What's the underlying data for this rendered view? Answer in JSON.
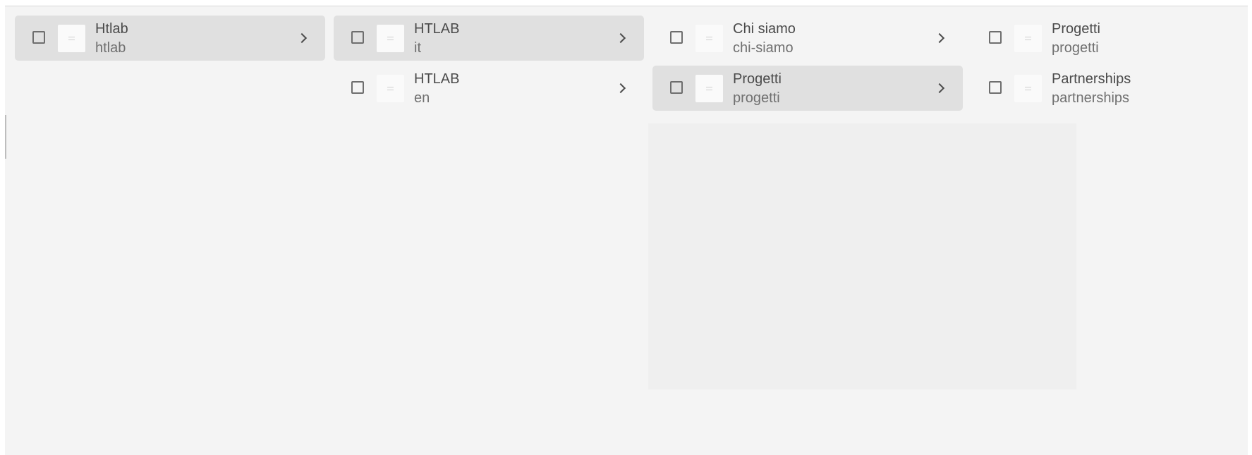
{
  "colors": {
    "background": "#f4f4f4",
    "selected_row": "#e0e0e0",
    "text_primary": "#4b4b4b",
    "text_secondary": "#707070"
  },
  "columns": [
    {
      "items": [
        {
          "title": "Htlab",
          "name": "htlab",
          "selected": true,
          "has_children": true,
          "thumb_icon": "page-thumbnail-icon"
        }
      ]
    },
    {
      "items": [
        {
          "title": "HTLAB",
          "name": "it",
          "selected": true,
          "has_children": true,
          "thumb_icon": "page-thumbnail-icon"
        },
        {
          "title": "HTLAB",
          "name": "en",
          "selected": false,
          "has_children": true,
          "thumb_icon": "page-thumbnail-icon"
        }
      ]
    },
    {
      "items": [
        {
          "title": "Chi siamo",
          "name": "chi-siamo",
          "selected": false,
          "has_children": true,
          "thumb_icon": "page-thumbnail-icon"
        },
        {
          "title": "Progetti",
          "name": "progetti",
          "selected": true,
          "has_children": true,
          "thumb_icon": "page-thumbnail-icon"
        }
      ]
    },
    {
      "items": [
        {
          "title": "Progetti",
          "name": "progetti",
          "selected": false,
          "has_children": false,
          "thumb_icon": "page-thumbnail-icon"
        },
        {
          "title": "Partnerships",
          "name": "partnerships",
          "selected": false,
          "has_children": false,
          "thumb_icon": "page-thumbnail-icon"
        }
      ]
    }
  ]
}
